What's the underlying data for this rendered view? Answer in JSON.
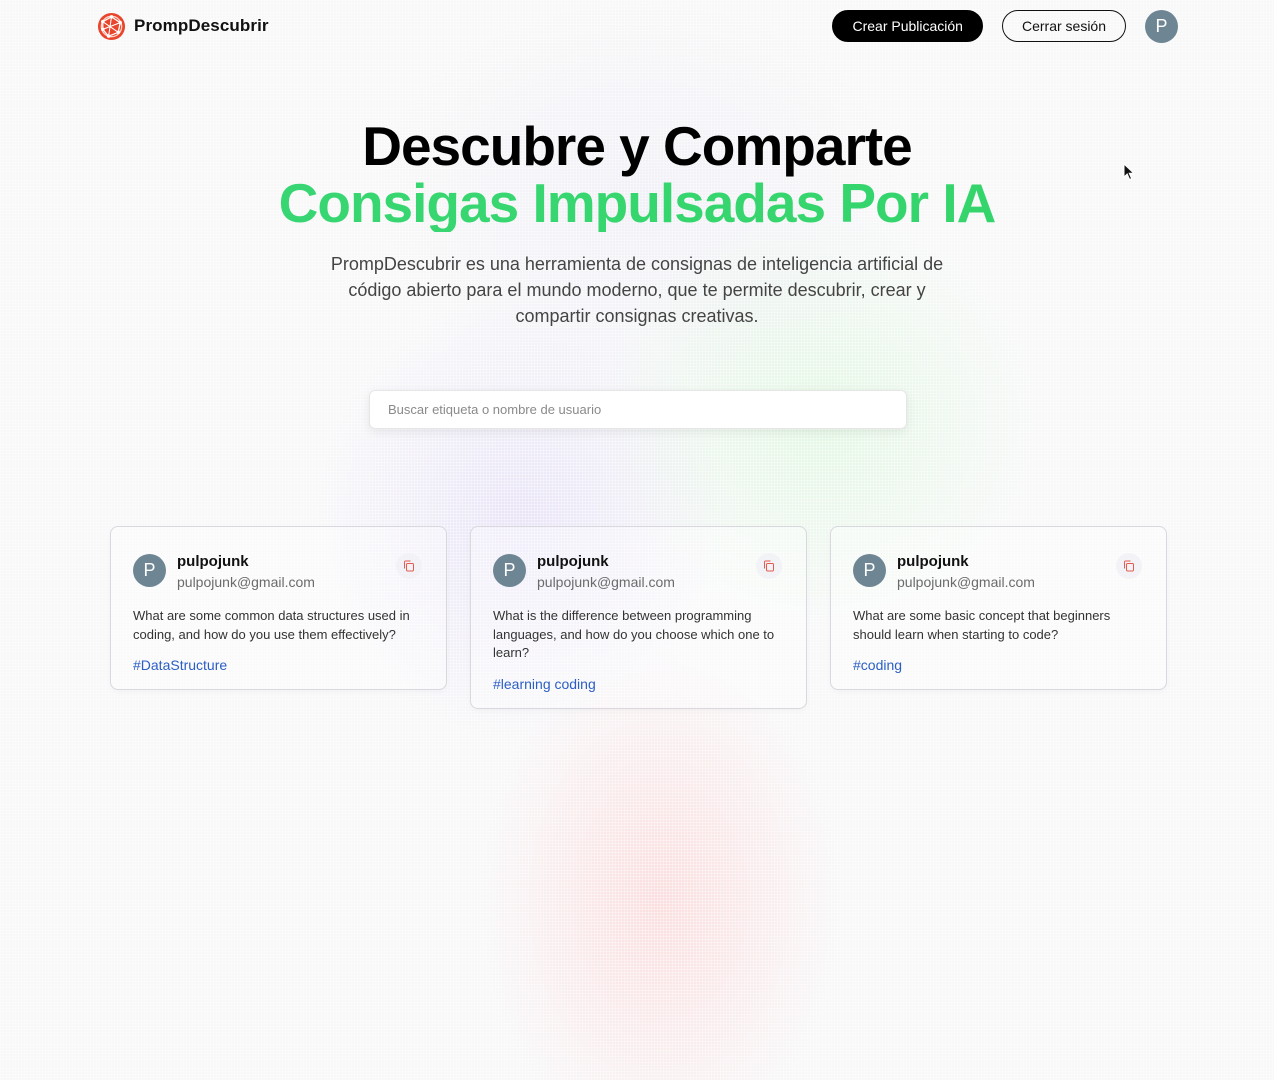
{
  "nav": {
    "brand": "PrompDescubrir",
    "logo_icon": "globe-network-icon",
    "create_label": "Crear Publicación",
    "logout_label": "Cerrar sesión",
    "avatar_initial": "P"
  },
  "hero": {
    "title_line1": "Descubre y Comparte",
    "title_line2": "Consigas Impulsadas Por IA",
    "description": "PrompDescubrir es una herramienta de consignas de inteligencia artificial de código abierto para el mundo moderno, que te permite descubrir, crear y compartir consignas creativas."
  },
  "search": {
    "placeholder": "Buscar etiqueta o nombre de usuario"
  },
  "colors": {
    "accent_green": "#33d46a",
    "avatar": "#6e8593",
    "tag_blue": "#2b5ec4",
    "copy_icon": "#e35b4c"
  },
  "cards": [
    {
      "avatar_initial": "P",
      "username": "pulpojunk",
      "email": "pulpojunk@gmail.com",
      "prompt": "What are some common data structures used in coding, and how do you use them effectively?",
      "tag": "#DataStructure",
      "icon": "copy-icon"
    },
    {
      "avatar_initial": "P",
      "username": "pulpojunk",
      "email": "pulpojunk@gmail.com",
      "prompt": "What is the difference between programming languages, and how do you choose which one to learn?",
      "tag": "#learning coding",
      "icon": "copy-icon"
    },
    {
      "avatar_initial": "P",
      "username": "pulpojunk",
      "email": "pulpojunk@gmail.com",
      "prompt": "What are some basic concept that beginners should learn when starting to code?",
      "tag": "#coding",
      "icon": "copy-icon"
    }
  ]
}
